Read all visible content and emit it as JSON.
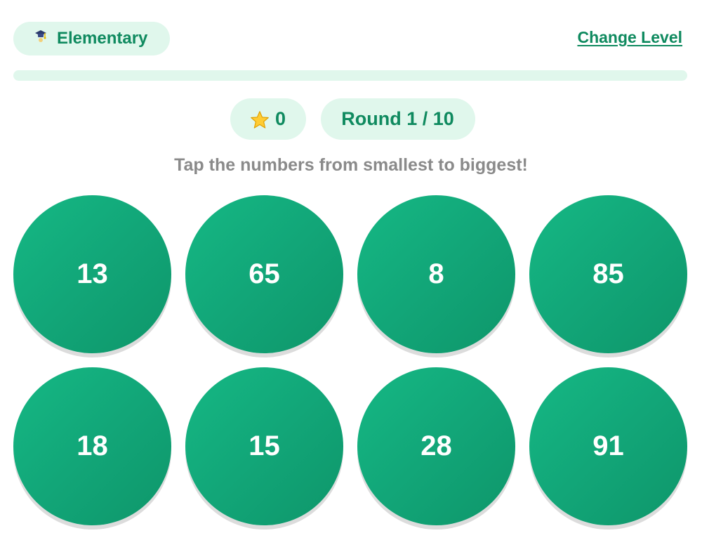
{
  "header": {
    "level_icon": "graduation-cap-icon",
    "level_label": "Elementary",
    "change_level_label": "Change Level"
  },
  "progress": {
    "fraction": 0.0
  },
  "stats": {
    "score_icon": "star-icon",
    "score": "0",
    "round_label": "Round 1 / 10"
  },
  "instruction": "Tap the numbers from smallest to biggest!",
  "numbers": [
    "13",
    "65",
    "8",
    "85",
    "18",
    "15",
    "28",
    "91"
  ],
  "colors": {
    "accent": "#12b07d",
    "accent_dark": "#0f8a5f",
    "pill_bg": "#e0f7ec",
    "instruction": "#8a8a8a"
  }
}
